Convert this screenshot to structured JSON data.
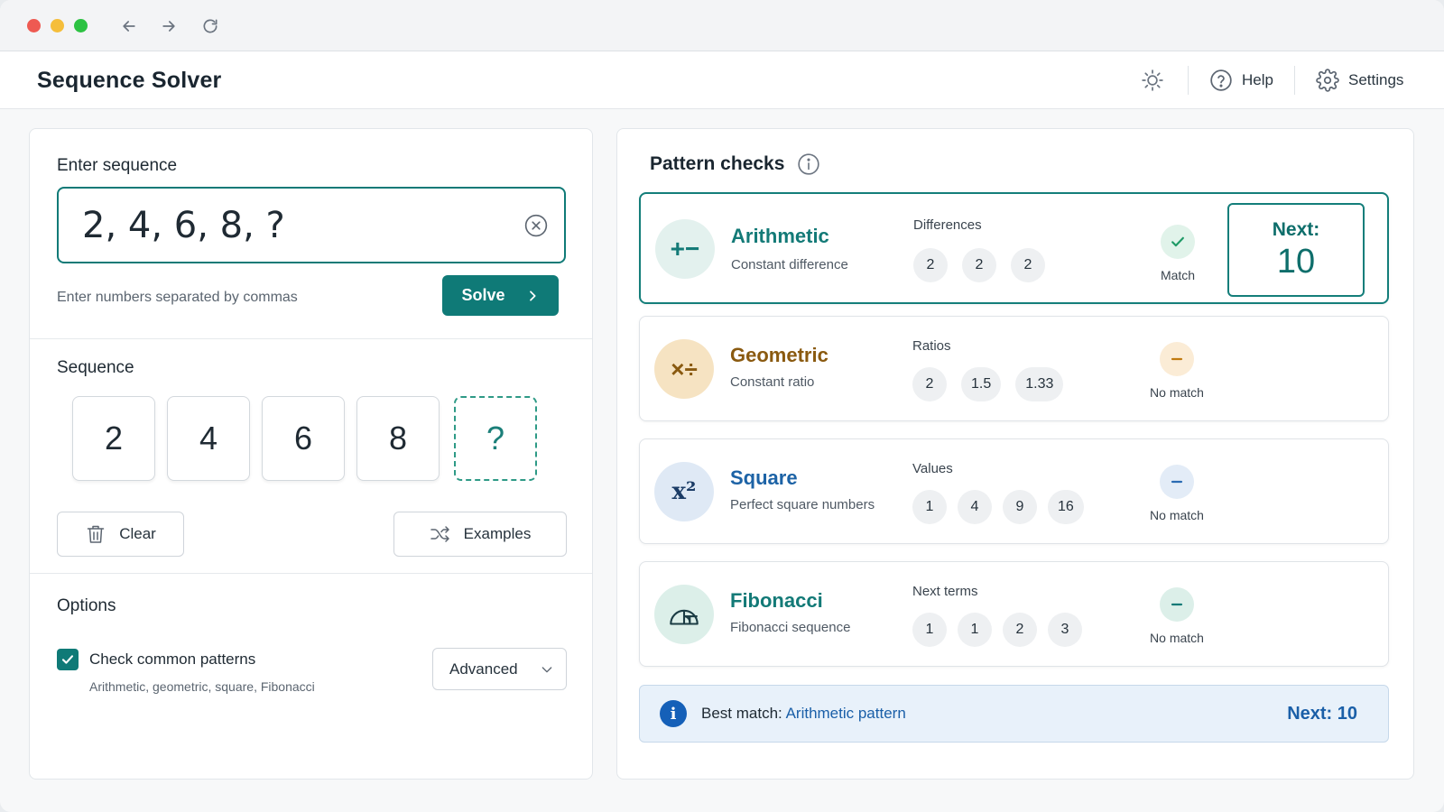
{
  "app": {
    "title": "Sequence Solver"
  },
  "header": {
    "help_label": "Help",
    "settings_label": "Settings"
  },
  "input": {
    "section_label": "Enter sequence",
    "value": "2, 4, 6, 8, ?",
    "hint": "Enter numbers separated by commas",
    "solve_label": "Solve"
  },
  "sequence": {
    "section_label": "Sequence",
    "tiles": [
      "2",
      "4",
      "6",
      "8",
      "?"
    ],
    "clear_label": "Clear",
    "examples_label": "Examples"
  },
  "options": {
    "section_label": "Options",
    "check_label": "Check common patterns",
    "check_checked": true,
    "check_sub": "Arithmetic, geometric, square, Fibonacci",
    "select_value": "Advanced"
  },
  "patterns": {
    "title": "Pattern checks",
    "items": [
      {
        "icon_text": "+−",
        "name": "Arithmetic",
        "desc": "Constant difference",
        "values_label": "Differences",
        "values": [
          "2",
          "2",
          "2"
        ],
        "status": "Match",
        "next_label": "Next:",
        "next_value": "10",
        "color": "#137a77",
        "icon_bg": "#e3f1ee"
      },
      {
        "icon_text": "×÷",
        "name": "Geometric",
        "desc": "Constant ratio",
        "values_label": "Ratios",
        "values": [
          "2",
          "1.5",
          "1.33"
        ],
        "status": "No match",
        "color": "#8a5a10",
        "icon_bg": "#f6e3c2"
      },
      {
        "icon_text": "x²",
        "name": "Square",
        "desc": "Perfect square numbers",
        "values_label": "Values",
        "values": [
          "1",
          "4",
          "9",
          "16"
        ],
        "status": "No match",
        "color": "#1d63a6",
        "icon_bg": "#dfe9f5"
      },
      {
        "icon_text": "",
        "name": "Fibonacci",
        "desc": "Fibonacci sequence",
        "values_label": "Next terms",
        "values": [
          "1",
          "1",
          "2",
          "3"
        ],
        "status": "No match",
        "color": "#137a77",
        "icon_bg": "#dcefe9"
      }
    ]
  },
  "best_match": {
    "prefix": "Best match:",
    "pattern": "Arithmetic pattern",
    "next": "Next: 10"
  },
  "colors": {
    "accent": "#0f7a77",
    "info": "#1560b8",
    "no_match": "#d9a452"
  }
}
